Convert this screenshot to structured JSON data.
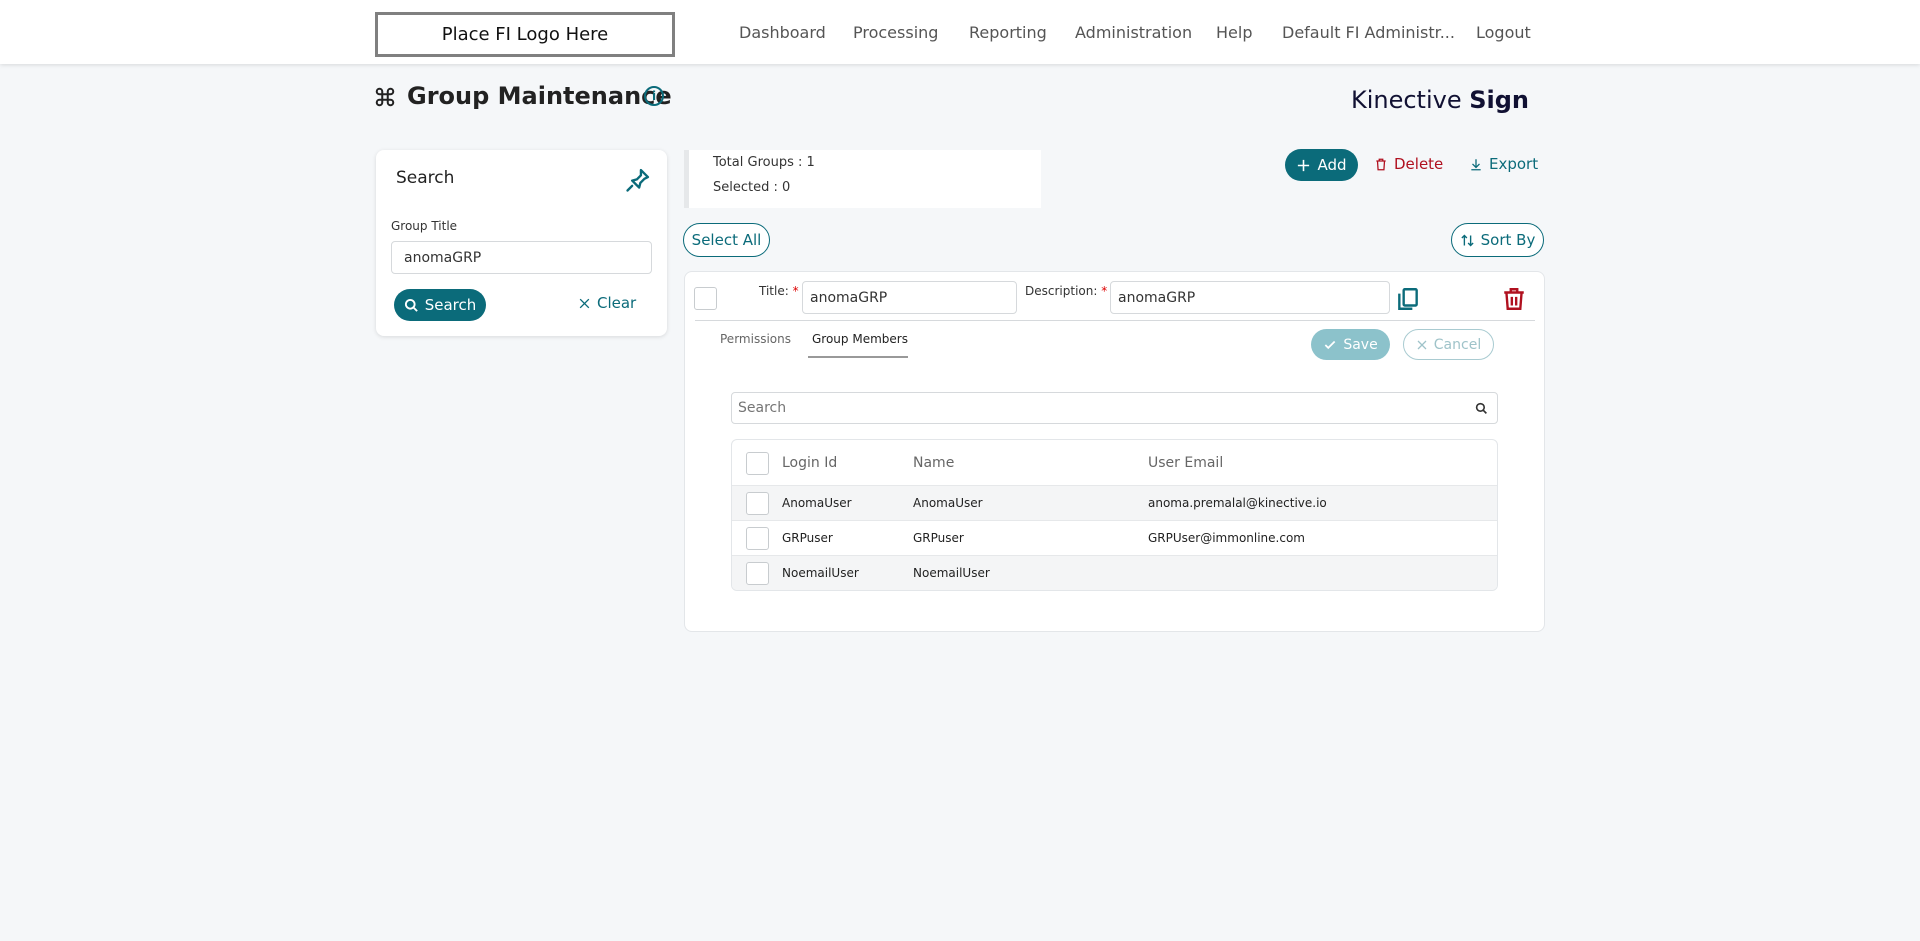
{
  "header": {
    "logo_text": "Place FI Logo Here",
    "nav": [
      "Dashboard",
      "Processing",
      "Reporting",
      "Administration",
      "Help",
      "Default FI Administr...",
      "Logout"
    ]
  },
  "page": {
    "title": "Group Maintenance",
    "info_icon": "i",
    "brand_light": "Kinective",
    "brand_bold": "Sign"
  },
  "search_panel": {
    "title": "Search",
    "group_title_label": "Group Title",
    "group_title_value": "anomaGRP",
    "search_button": "Search",
    "clear_button": "Clear"
  },
  "summary": {
    "total_groups": "Total Groups : 1",
    "selected": "Selected : 0"
  },
  "toolbar": {
    "add": "Add",
    "delete": "Delete",
    "export": "Export",
    "select_all": "Select All",
    "sort_by": "Sort By"
  },
  "group": {
    "title_label": "Title:",
    "title_value": "anomaGRP",
    "description_label": "Description:",
    "description_value": "anomaGRP",
    "required_marker": "*",
    "tabs": [
      "Permissions",
      "Group Members"
    ],
    "save": "Save",
    "cancel": "Cancel",
    "member_search_placeholder": "Search",
    "columns": [
      "Login Id",
      "Name",
      "User Email"
    ],
    "members": [
      {
        "login": "AnomaUser",
        "name": "AnomaUser",
        "email": "anoma.premalal@kinective.io"
      },
      {
        "login": "GRPuser",
        "name": "GRPuser",
        "email": "GRPUser@immonline.com"
      },
      {
        "login": "NoemailUser",
        "name": "NoemailUser",
        "email": ""
      }
    ]
  },
  "colors": {
    "accent": "#0b6b7a",
    "danger": "#b0101f",
    "background": "#f5f7f9"
  }
}
